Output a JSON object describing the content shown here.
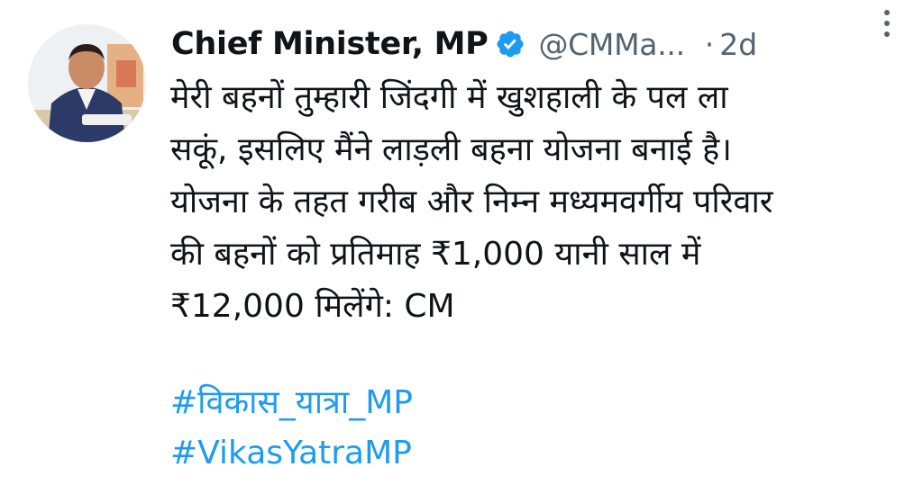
{
  "tweet": {
    "author": {
      "display_name": "Chief Minister, MP",
      "handle": "@CMMa...",
      "verified": true
    },
    "separator": "·",
    "timestamp": "2d",
    "text_lines": [
      "मेरी बहनों तुम्हारी जिंदगी में खुशहाली के पल ला",
      "सकूं, इसलिए मैंने लाड़ली बहना योजना बनाई है।",
      "योजना के तहत गरीब और निम्न मध्यमवर्गीय परिवार",
      "की बहनों को प्रतिमाह ₹1,000 यानी साल में",
      "₹12,000 मिलेंगे: CM"
    ],
    "hashtags": [
      "#विकास_यात्रा_MP",
      "#VikasYatraMP"
    ]
  },
  "icons": {
    "more": "more-vertical-icon",
    "verified": "verified-badge-icon"
  },
  "colors": {
    "text": "#0f1419",
    "secondary": "#536471",
    "link": "#1d9bf0",
    "verified": "#1d9bf0"
  }
}
